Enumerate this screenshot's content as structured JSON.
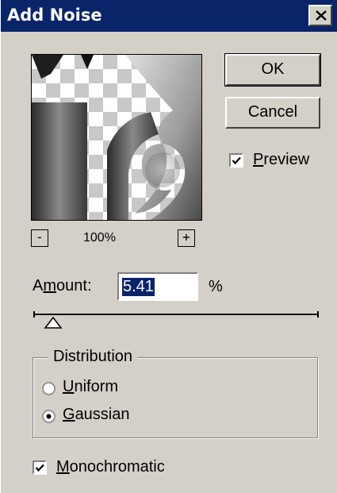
{
  "dialog": {
    "title": "Add Noise",
    "close_icon": "close-icon"
  },
  "buttons": {
    "ok": "OK",
    "cancel": "Cancel"
  },
  "preview_option": {
    "label_first": "P",
    "label_rest": "review",
    "checked": true
  },
  "zoom": {
    "minus": "-",
    "plus": "+",
    "level": "100%"
  },
  "amount": {
    "label_a": "A",
    "label_m": "m",
    "label_rest": "ount:",
    "value": "5.41",
    "unit": "%"
  },
  "distribution": {
    "title": "Distribution",
    "uniform_first": "U",
    "uniform_rest": "niform",
    "gaussian_first": "G",
    "gaussian_rest": "aussian",
    "selected": "Gaussian"
  },
  "monochromatic": {
    "label_first": "M",
    "label_rest": "onochromatic",
    "checked": true
  },
  "colors": {
    "title_bar": "#0a246a",
    "face": "#d4d0c8"
  }
}
